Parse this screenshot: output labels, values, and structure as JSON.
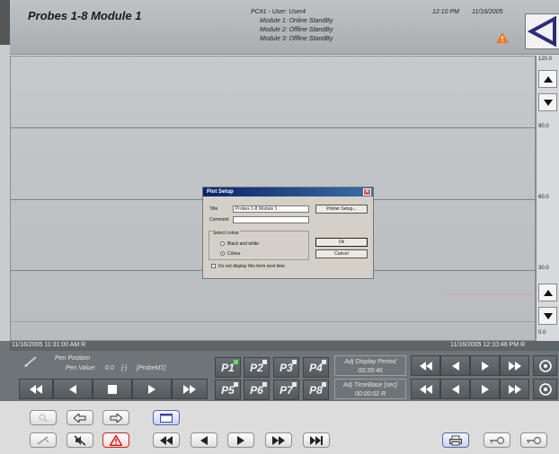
{
  "header": {
    "title": "Probes 1-8 Module 1",
    "status_lines": [
      "PC#1 - User: User4",
      "Module 1: Online StandBy",
      "Module 2: Offline StandBy",
      "Module 3: Offline StandBy"
    ],
    "time": "12:10 PM",
    "date": "11/16/2005",
    "alarm_icon": "warning-triangle-icon",
    "back_icon": "back-arrow-icon"
  },
  "plot": {
    "y_labels": [
      "120.0",
      "90.0",
      "60.0",
      "30.0",
      "0.0"
    ],
    "start_time": "11/16/2005 11:31:00 AM R",
    "end_time": "11/16/2005 12:10:46 PM R",
    "colors": {
      "grid": "#7c8287",
      "trace": "#d9a0a0"
    }
  },
  "controls": {
    "pen_position_label": "Pen Position",
    "pen_value_label": "Pen Value:",
    "pen_value": "0.0",
    "pen_value_box": "[-]",
    "pen_probe": "[ProbeM1]",
    "probes_top": [
      "P1",
      "P2",
      "P3",
      "P4"
    ],
    "probes_bottom": [
      "P5",
      "P6",
      "P7",
      "P8"
    ],
    "adj_display_label": "Adj Display Period",
    "adj_display_value": "00:39:46",
    "adj_timebase_label": "Adj TimeBase [sec]",
    "adj_timebase_value": "00:00:02 R"
  },
  "dialog": {
    "title": "Plot Setup",
    "title_label": "Title",
    "title_value": "Probes 1-8 Module 1",
    "comment_label": "Comment",
    "comment_value": "",
    "printer_button": "Printer Setup...",
    "group_label": "Select colour",
    "option_bw": "Black and white",
    "option_colour": "Colour",
    "ok_button": "Ok",
    "cancel_button": "Cancel",
    "checkbox_label": "Do not display this form next time"
  }
}
